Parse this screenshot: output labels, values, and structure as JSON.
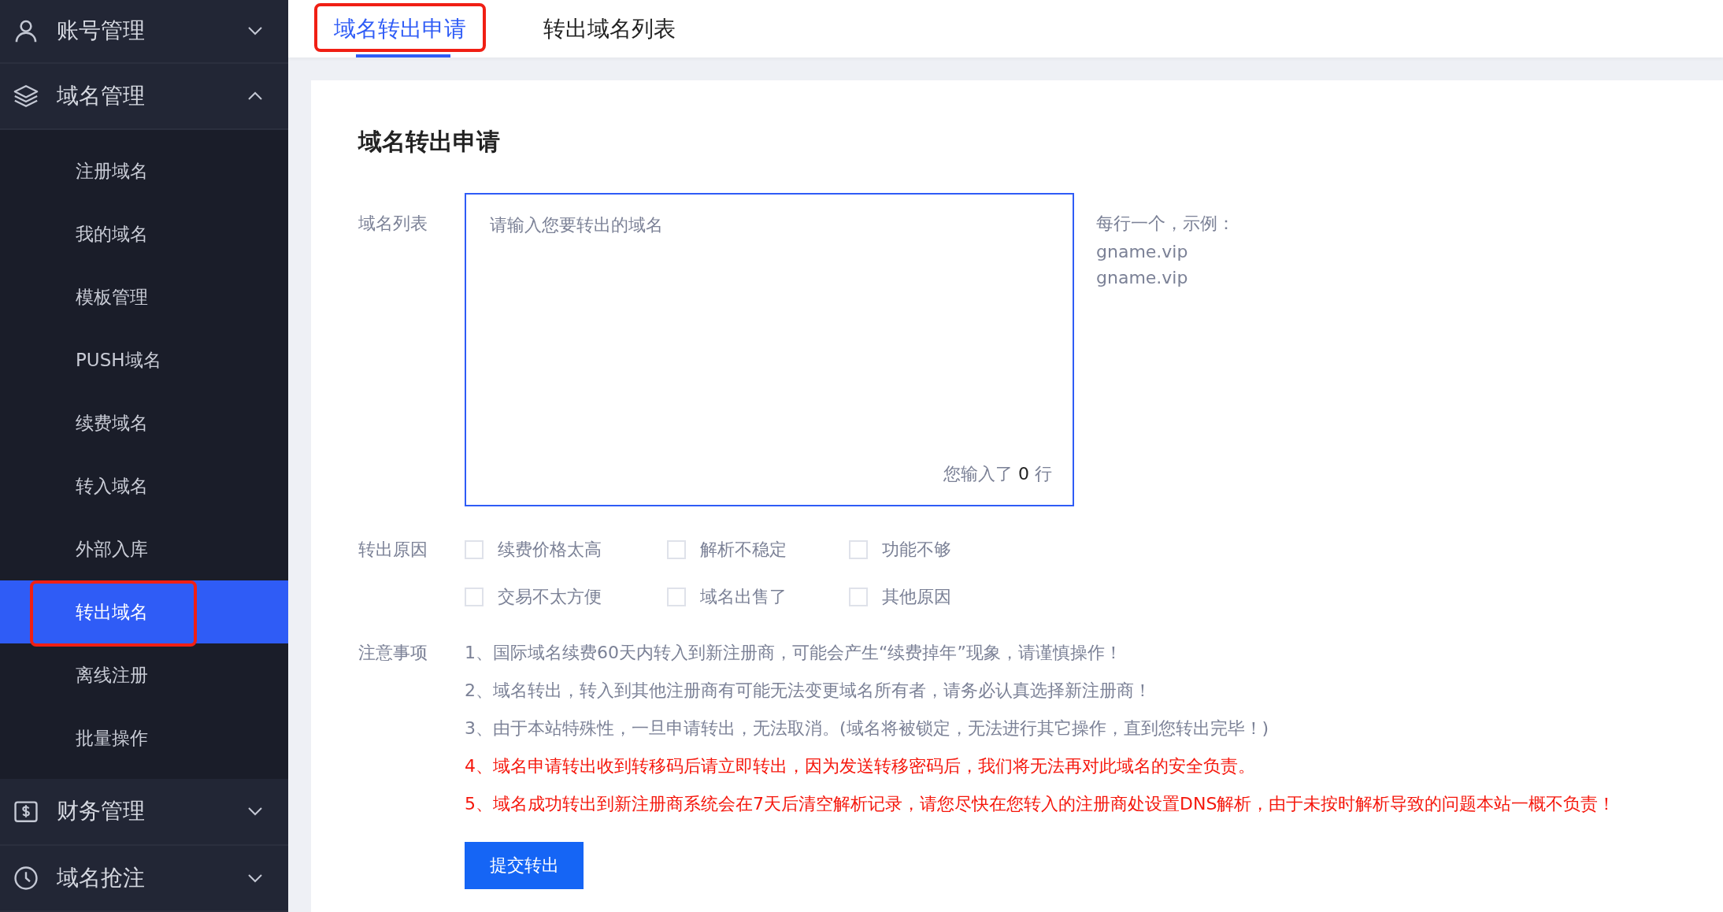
{
  "sidebar": {
    "groups": [
      {
        "label": "账号管理",
        "expanded": false
      },
      {
        "label": "域名管理",
        "expanded": true,
        "children": [
          {
            "label": "注册域名",
            "selected": false,
            "highlighted": false
          },
          {
            "label": "我的域名",
            "selected": false,
            "highlighted": false
          },
          {
            "label": "模板管理",
            "selected": false,
            "highlighted": false
          },
          {
            "label": "PUSH域名",
            "selected": false,
            "highlighted": false
          },
          {
            "label": "续费域名",
            "selected": false,
            "highlighted": false
          },
          {
            "label": "转入域名",
            "selected": false,
            "highlighted": false
          },
          {
            "label": "外部入库",
            "selected": false,
            "highlighted": false
          },
          {
            "label": "转出域名",
            "selected": true,
            "highlighted": true
          },
          {
            "label": "离线注册",
            "selected": false,
            "highlighted": false
          },
          {
            "label": "批量操作",
            "selected": false,
            "highlighted": false
          }
        ]
      },
      {
        "label": "财务管理",
        "expanded": false
      },
      {
        "label": "域名抢注",
        "expanded": false
      }
    ]
  },
  "tabs": [
    {
      "label": "域名转出申请",
      "selected": true,
      "highlighted": true
    },
    {
      "label": "转出域名列表",
      "selected": false,
      "highlighted": false
    }
  ],
  "form": {
    "title": "域名转出申请",
    "domain_list": {
      "label": "域名列表",
      "placeholder": "请输入您要转出的域名",
      "counter_prefix": "您输入了",
      "count": "0",
      "counter_suffix": "行"
    },
    "hint": [
      "每行一个，示例：",
      "gname.vip",
      "gname.vip"
    ],
    "reasons": {
      "label": "转出原因",
      "options": [
        {
          "label": "续费价格太高",
          "checked": false
        },
        {
          "label": "解析不稳定",
          "checked": false
        },
        {
          "label": "功能不够",
          "checked": false
        },
        {
          "label": "交易不太方便",
          "checked": false
        },
        {
          "label": "域名出售了",
          "checked": false
        },
        {
          "label": "其他原因",
          "checked": false
        }
      ]
    },
    "notes": {
      "label": "注意事项",
      "items": [
        {
          "text": "1、国际域名续费60天内转入到新注册商，可能会产生“续费掉年”现象，请谨慎操作！",
          "kind": "normal"
        },
        {
          "text": "2、域名转出，转入到其他注册商有可能无法变更域名所有者，请务必认真选择新注册商！",
          "kind": "normal"
        },
        {
          "text": "3、由于本站特殊性，一旦申请转出，无法取消。(域名将被锁定，无法进行其它操作，直到您转出完毕！)",
          "kind": "normal"
        },
        {
          "text": "4、域名申请转出收到转移码后请立即转出，因为发送转移密码后，我们将无法再对此域名的安全负责。",
          "kind": "warning"
        },
        {
          "text": "5、域名成功转出到新注册商系统会在7天后清空解析记录，请您尽快在您转入的注册商处设置DNS解析，由于未按时解析导致的问题本站一概不负责！",
          "kind": "warning"
        }
      ]
    },
    "submit": "提交转出"
  }
}
